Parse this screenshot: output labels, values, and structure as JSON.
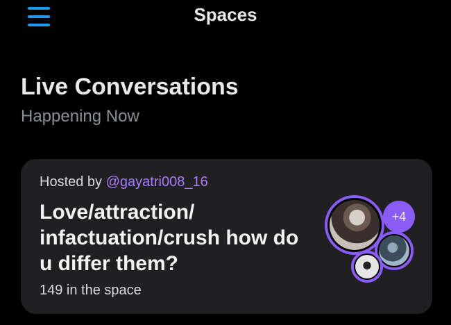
{
  "header": {
    "title": "Spaces",
    "menu_icon": "hamburger-menu-icon",
    "accent_color": "#1d9bf0"
  },
  "section": {
    "title": "Live Conversations",
    "subtitle": "Happening Now"
  },
  "space_card": {
    "hosted_by_label": "Hosted by",
    "host_handle": "@gayatri008_16",
    "title": "Love/attraction/ infactuation/crush how do u differ them?",
    "listener_count": "149 in the space",
    "extra_speakers": "+4",
    "accent_color": "#8a5cf5"
  }
}
